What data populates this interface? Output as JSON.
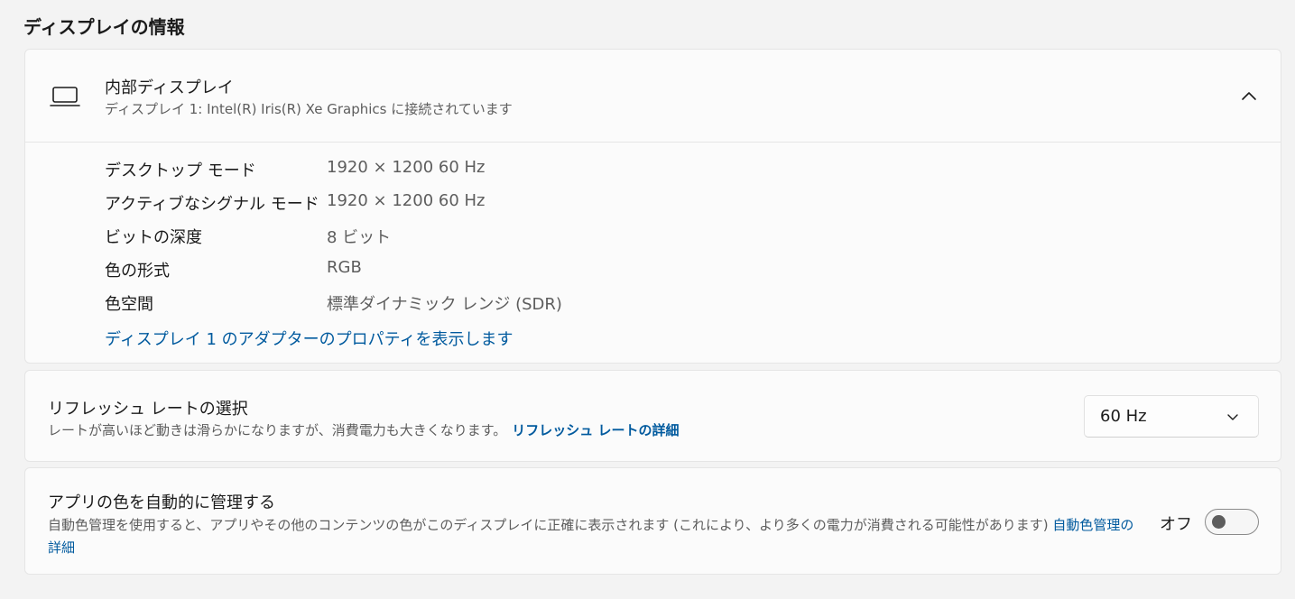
{
  "section": {
    "title": "ディスプレイの情報"
  },
  "display": {
    "name": "内部ディスプレイ",
    "subtitle": "ディスプレイ 1: Intel(R) Iris(R) Xe Graphics に接続されています",
    "icon": "laptop-icon",
    "expanded": true,
    "info": [
      {
        "label": "デスクトップ モード",
        "value": "1920 × 1200 60 Hz"
      },
      {
        "label": "アクティブなシグナル モード",
        "value": "1920 × 1200 60 Hz"
      },
      {
        "label": "ビットの深度",
        "value": "8 ビット"
      },
      {
        "label": "色の形式",
        "value": "RGB"
      },
      {
        "label": "色空間",
        "value": "標準ダイナミック レンジ (SDR)"
      }
    ],
    "adapter_link": "ディスプレイ 1 のアダプターのプロパティを表示します"
  },
  "refresh": {
    "title": "リフレッシュ レートの選択",
    "description": "レートが高いほど動きは滑らかになりますが、消費電力も大きくなります。",
    "link": "リフレッシュ レートの詳細",
    "selected": "60 Hz"
  },
  "auto_color": {
    "title": "アプリの色を自動的に管理する",
    "description": "自動色管理を使用すると、アプリやその他のコンテンツの色がこのディスプレイに正確に表示されます (これにより、より多くの電力が消費される可能性があります)",
    "link": "自動色管理の詳細",
    "toggle_label": "オフ",
    "toggle_on": false
  },
  "colors": {
    "background": "#f3f3f3",
    "card": "#fbfbfb",
    "link": "#005a9e",
    "secondary_text": "#5d5d5d"
  }
}
